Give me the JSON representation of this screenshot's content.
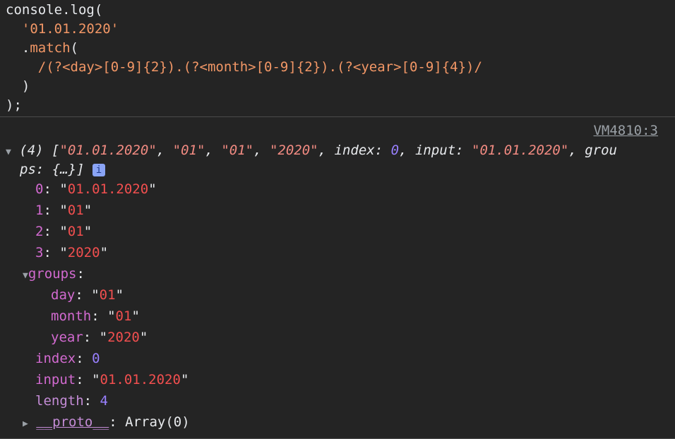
{
  "code": {
    "line1": "console.log(",
    "line2": "'01.01.2020'",
    "line3_dot": ".",
    "line3_fn": "match",
    "line3_paren": "(",
    "line4": "/(?<day>[0-9]{2}).(?<month>[0-9]{2}).(?<year>[0-9]{4})/",
    "line5": ")",
    "line6": ");"
  },
  "console": {
    "source_link": "VM4810:3",
    "summary": {
      "count": "(4) [",
      "s0": "\"01.01.2020\"",
      "s1": "\"01\"",
      "s2": "\"01\"",
      "s3": "\"2020\"",
      "index_label": "index",
      "index_value": "0",
      "input_label": "input",
      "input_value": "\"01.01.2020\"",
      "groups_tail": "grou",
      "groups_wrap": "ps: {…}]",
      "info_badge": "i"
    },
    "entries": [
      {
        "key": "0",
        "value": "01.01.2020"
      },
      {
        "key": "1",
        "value": "01"
      },
      {
        "key": "2",
        "value": "01"
      },
      {
        "key": "3",
        "value": "2020"
      }
    ],
    "groups": {
      "label": "groups",
      "items": [
        {
          "key": "day",
          "value": "01"
        },
        {
          "key": "month",
          "value": "01"
        },
        {
          "key": "year",
          "value": "2020"
        }
      ]
    },
    "index": {
      "key": "index",
      "value": "0"
    },
    "input": {
      "key": "input",
      "value": "01.01.2020"
    },
    "length": {
      "key": "length",
      "value": "4"
    },
    "proto": {
      "key": "__proto__",
      "value": "Array(0)"
    }
  }
}
